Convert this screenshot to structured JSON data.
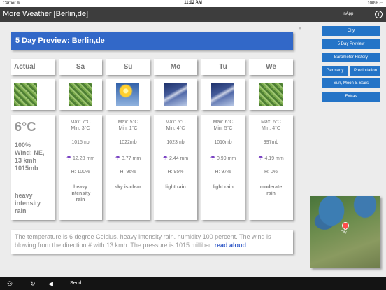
{
  "status_bar": {
    "carrier": "Carrier ≋",
    "time": "11:02 AM",
    "battery": "100% ▭"
  },
  "nav": {
    "title": "More Weather [Berlin,de]",
    "inapp": "inApp",
    "info_glyph": "i"
  },
  "close_glyph": "x",
  "header": {
    "title": "5 Day Preview: Berlin,de"
  },
  "right_buttons": [
    {
      "label": "City"
    },
    {
      "label": "5 Day Preview"
    },
    {
      "label": "Barometer History"
    },
    {
      "label": "Germany"
    },
    {
      "label": "Precipitation"
    },
    {
      "label": "Sun, Moon & Stars"
    },
    {
      "label": "Extras"
    }
  ],
  "actual": {
    "heading": "Actual",
    "icon": "heavy-rain-icon",
    "temp": "6°C",
    "humidity": "100%",
    "wind": "Wind: NE,",
    "wind_speed": "13 kmh",
    "pressure": "1015mb",
    "description_1": "heavy",
    "description_2": "intensity",
    "description_3": "rain"
  },
  "days": [
    {
      "day": "Sa",
      "icon": "heavy-rain-icon",
      "max": "Max: 7°C",
      "min": "Min: 3°C",
      "pressure": "1015mb",
      "precip": "12,28 mm",
      "humidity": "H: 100%",
      "description": "heavy intensity rain"
    },
    {
      "day": "Su",
      "icon": "clear-sky-icon",
      "max": "Max: 5°C",
      "min": "Min: 1°C",
      "pressure": "1022mb",
      "precip": "3,77 mm",
      "humidity": "H: 96%",
      "description": "sky is clear"
    },
    {
      "day": "Mo",
      "icon": "light-rain-icon",
      "max": "Max: 5°C",
      "min": "Min: 4°C",
      "pressure": "1023mb",
      "precip": "2,44 mm",
      "humidity": "H: 95%",
      "description": "light rain"
    },
    {
      "day": "Tu",
      "icon": "light-rain-icon",
      "max": "Max: 6°C",
      "min": "Min: 5°C",
      "pressure": "1010mb",
      "precip": "0,99 mm",
      "humidity": "H: 97%",
      "description": "light rain"
    },
    {
      "day": "We",
      "icon": "moderate-rain-icon",
      "max": "Max: 6°C",
      "min": "Min: 4°C",
      "pressure": "997mb",
      "precip": "4,19 mm",
      "humidity": "H: 0%",
      "description": "moderate rain"
    }
  ],
  "summary": {
    "text": "The temperature is 6 degree Celsius. heavy intensity rain. humidity 100 percent. The wind is blowing from the direction # with 13 kmh. The pressure is 1015 millibar.",
    "read_aloud": "read aloud"
  },
  "map": {
    "pin_label": "City"
  },
  "bottom_bar": {
    "send_label": "Send",
    "back_glyph": "◀",
    "refresh_glyph": "↻",
    "share_glyph": "⚇"
  },
  "colors": {
    "accent": "#3268c8",
    "button": "#2474c7",
    "navbar": "#3d3d3d",
    "umbrella": "#7a43c3"
  }
}
